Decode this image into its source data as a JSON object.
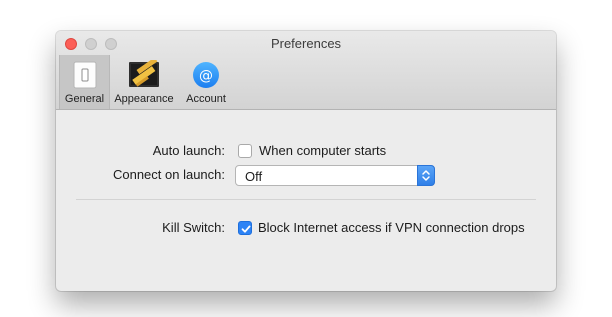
{
  "window": {
    "title": "Preferences"
  },
  "toolbar": {
    "items": [
      {
        "label": "General",
        "icon": "general-switch-icon",
        "selected": true
      },
      {
        "label": "Appearance",
        "icon": "appearance-icon",
        "selected": false
      },
      {
        "label": "Account",
        "icon": "account-at-icon",
        "selected": false
      }
    ]
  },
  "settings": {
    "auto_launch": {
      "label": "Auto launch:",
      "checkbox_label": "When computer starts",
      "checked": false
    },
    "connect_on_launch": {
      "label": "Connect on launch:",
      "value": "Off"
    },
    "kill_switch": {
      "label": "Kill Switch:",
      "checkbox_label": "Block Internet access if VPN connection drops",
      "checked": true
    }
  },
  "colors": {
    "accent": "#2d83f5",
    "close_button": "#fc5f57"
  }
}
